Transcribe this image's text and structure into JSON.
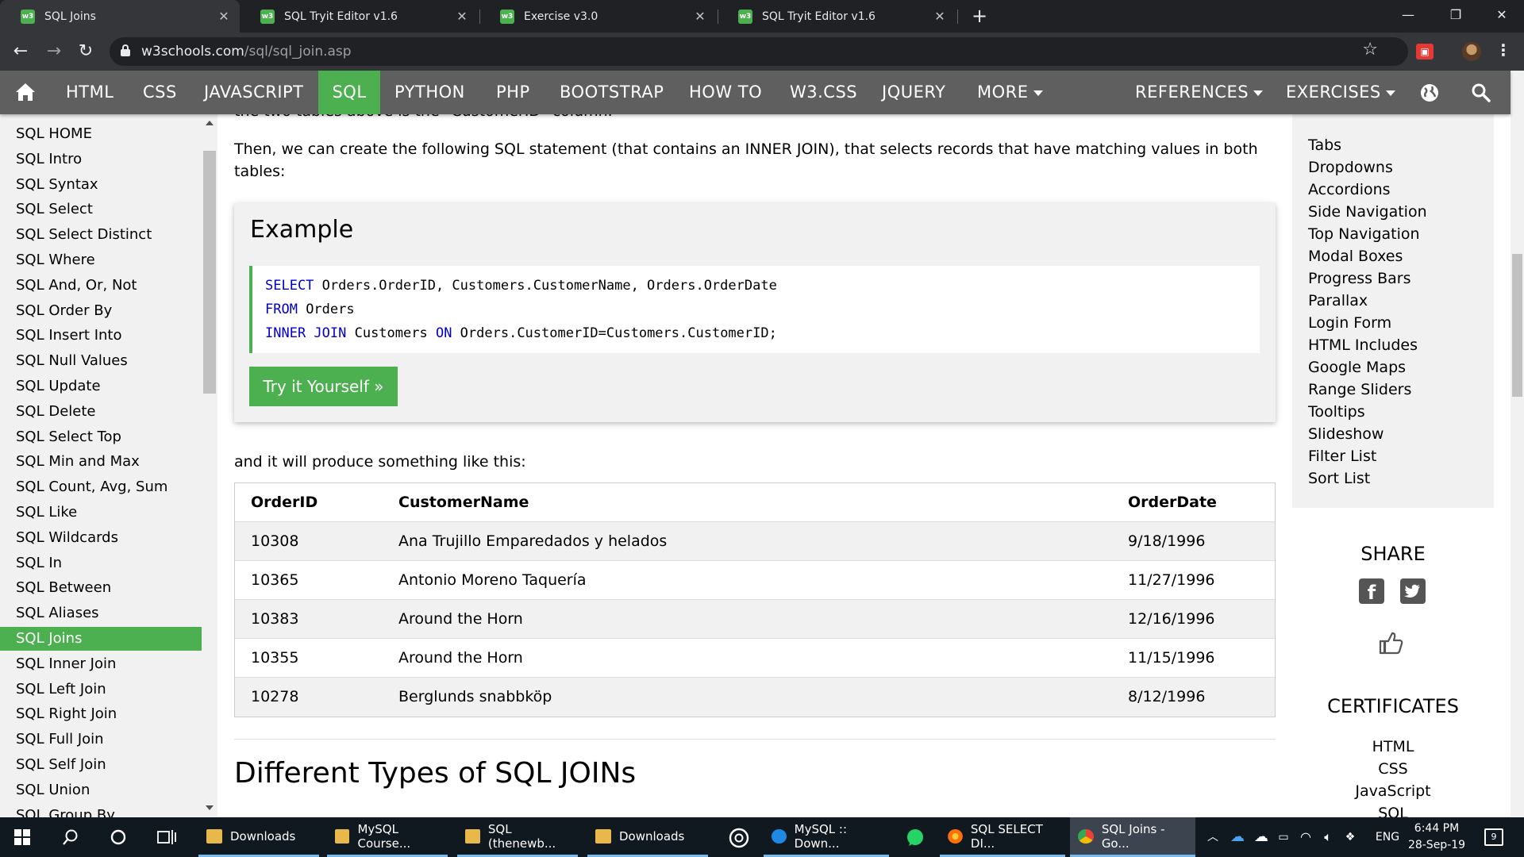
{
  "browser": {
    "tabs": [
      {
        "title": "SQL Joins",
        "favicon": "w3"
      },
      {
        "title": "SQL Tryit Editor v1.6",
        "favicon": "w3"
      },
      {
        "title": "Exercise v3.0",
        "favicon": "w3"
      },
      {
        "title": "SQL Tryit Editor v1.6",
        "favicon": "w3"
      }
    ],
    "url_host": "w3schools.com",
    "url_path": "/sql/sql_join.asp"
  },
  "topnav": {
    "items": [
      "HTML",
      "CSS",
      "JAVASCRIPT",
      "SQL",
      "PYTHON",
      "PHP",
      "BOOTSTRAP",
      "HOW TO",
      "W3.CSS",
      "JQUERY",
      "MORE"
    ],
    "active": "SQL",
    "references": "REFERENCES",
    "exercises": "EXERCISES"
  },
  "sidebar": {
    "items": [
      "SQL HOME",
      "SQL Intro",
      "SQL Syntax",
      "SQL Select",
      "SQL Select Distinct",
      "SQL Where",
      "SQL And, Or, Not",
      "SQL Order By",
      "SQL Insert Into",
      "SQL Null Values",
      "SQL Update",
      "SQL Delete",
      "SQL Select Top",
      "SQL Min and Max",
      "SQL Count, Avg, Sum",
      "SQL Like",
      "SQL Wildcards",
      "SQL In",
      "SQL Between",
      "SQL Aliases",
      "SQL Joins",
      "SQL Inner Join",
      "SQL Left Join",
      "SQL Right Join",
      "SQL Full Join",
      "SQL Self Join",
      "SQL Union",
      "SQL Group By"
    ],
    "active": "SQL Joins"
  },
  "main": {
    "cut_line": "the two tables above is the \"CustomerID\" column.",
    "intro": "Then, we can create the following SQL statement (that contains an INNER JOIN), that selects records that have matching values in both tables:",
    "example_title": "Example",
    "code": {
      "line1_kw": "SELECT",
      "line1_rest": " Orders.OrderID, Customers.CustomerName, Orders.OrderDate",
      "line2_kw": "FROM",
      "line2_rest": " Orders",
      "line3_kw1": "INNER JOIN",
      "line3_mid": " Customers ",
      "line3_kw2": "ON",
      "line3_rest": " Orders.CustomerID=Customers.CustomerID;"
    },
    "try_button": "Try it Yourself »",
    "result_intro": "and it will produce something like this:",
    "table": {
      "headers": [
        "OrderID",
        "CustomerName",
        "OrderDate"
      ],
      "rows": [
        [
          "10308",
          "Ana Trujillo Emparedados y helados",
          "9/18/1996"
        ],
        [
          "10365",
          "Antonio Moreno Taquería",
          "11/27/1996"
        ],
        [
          "10383",
          "Around the Horn",
          "12/16/1996"
        ],
        [
          "10355",
          "Around the Horn",
          "11/15/1996"
        ],
        [
          "10278",
          "Berglunds snabbköp",
          "8/12/1996"
        ]
      ]
    },
    "section_heading": "Different Types of SQL JOINs"
  },
  "rightcol": {
    "howto_links": [
      "Tabs",
      "Dropdowns",
      "Accordions",
      "Side Navigation",
      "Top Navigation",
      "Modal Boxes",
      "Progress Bars",
      "Parallax",
      "Login Form",
      "HTML Includes",
      "Google Maps",
      "Range Sliders",
      "Tooltips",
      "Slideshow",
      "Filter List",
      "Sort List"
    ],
    "share_title": "SHARE",
    "cert_title": "CERTIFICATES",
    "cert_links": [
      "HTML",
      "CSS",
      "JavaScript",
      "SQL"
    ]
  },
  "taskbar": {
    "apps": [
      {
        "label": "Downloads",
        "icon": "folder-icon"
      },
      {
        "label": "MySQL Course...",
        "icon": "folder-icon"
      },
      {
        "label": "SQL (thenewb...",
        "icon": "folder-icon"
      },
      {
        "label": "Downloads",
        "icon": "folder-icon"
      },
      {
        "label": "MySQL :: Down...",
        "icon": "edge-icon"
      },
      {
        "label": "SQL SELECT DI...",
        "icon": "firefox-icon"
      },
      {
        "label": "SQL Joins - Go...",
        "icon": "chrome-icon"
      }
    ],
    "lang": "ENG",
    "time": "6:44 PM",
    "date": "28-Sep-19",
    "notifications": "9"
  }
}
